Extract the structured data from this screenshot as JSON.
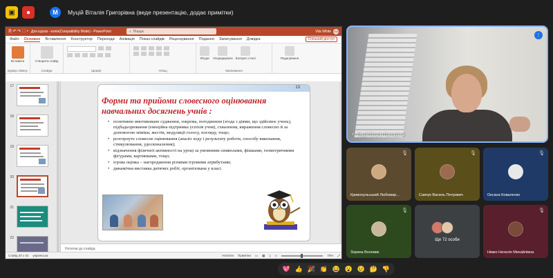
{
  "topbar": {
    "avatar_letter": "M",
    "title": "Муцій Віталія Григорівна (веде презентацію, додає примітки)"
  },
  "ppt": {
    "quick_access": "🗎 ↶ ↷ ⬚ ▾",
    "doc_title": "Для курсів - копія(Compatibility Mode) - PowerPoint",
    "search_placeholder": "Пошук",
    "user_name": "Vita White",
    "user_initials": "VW",
    "menu": [
      "Файл",
      "Основне",
      "Вставлення",
      "Конструктор",
      "Переходи",
      "Анімація",
      "Показ слайдів",
      "Рецензування",
      "Подання",
      "Записування",
      "Довідка"
    ],
    "share_label": "Спільний доступ",
    "ribbon": {
      "clipboard_label": "Буфер обміну",
      "paste_label": "Вставити",
      "new_slide_label": "Створити слайд",
      "slides_group": "Слайди",
      "font_group": "Шрифт",
      "paragraph_group": "Абзац",
      "figures_label": "Фігури",
      "arrange_label": "Упорядкувати",
      "styles_label": "Експрес-стилі",
      "drawing_group": "Малювання",
      "editing_label": "Редагування"
    },
    "thumb_numbers": [
      "17",
      "18",
      "19",
      "20",
      "21",
      "22"
    ],
    "slide": {
      "number": "13",
      "title": "Форми та прийоми словесного оцінювання навчальних досягнень учнів :",
      "bullets": [
        "позитивно вмотивоване судження, зокрема, погодження (згода з діями, що здійснює учень), підбадьорювання (емоційна підтримка успіхів учня), схвалення, вираження словесно й за допомогою міміки, жестів, модуляції голосу, погляду, тощо;",
        "розгорнуте словесне оцінювання (аналіз ходу і результату роботи, способу виконання, стимулювання, удосконалення);",
        "відзначення фізичної активності на уроці за умовними символами, фішками, геометричними фігурами, картинками, тощо;",
        "ігрова оцінка – нагородження різними ігровими атрибутами;",
        "динамічна виставка дитячих робіт, організована у класі."
      ]
    },
    "notes_placeholder": "Нотатки до слайда",
    "status": {
      "slide_info": "Слайд 20 з 42",
      "language": "українська",
      "notes_btn": "Нотатки",
      "comments_btn": "Примітки",
      "zoom": "75%"
    }
  },
  "speaker": {
    "name": "Муцій Віталія Григорівна"
  },
  "tiles": [
    {
      "name": "Кривохульський Любомир...",
      "bg": "#5b4a2e"
    },
    {
      "name": "Савчук Василь Петрович",
      "bg": "#5a4f1a"
    },
    {
      "name": "Оксана Коваленко",
      "bg": "#1f3a66"
    },
    {
      "name": "Зорина Воловик",
      "bg": "#2c4a1e"
    },
    {
      "name": "Ще 72 особи",
      "bg": "#3c4043"
    },
    {
      "name": "Німко Наталія Михайлівна",
      "bg": "#5a1f2c"
    }
  ],
  "reactions": [
    "💖",
    "👍",
    "🎉",
    "👏",
    "😂",
    "😮",
    "😢",
    "🤔",
    "👎"
  ],
  "colors": {
    "ppt_accent": "#b7472a",
    "slide_title": "#c0252c",
    "highlight": "#8ab4f8"
  }
}
